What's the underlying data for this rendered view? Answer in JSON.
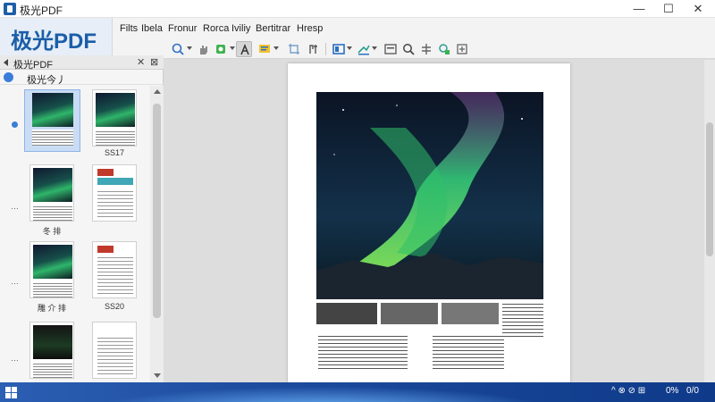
{
  "app": {
    "title": "极光PDF",
    "brand": "极光PDF"
  },
  "window_controls": {
    "minimize": "—",
    "maximize": "☐",
    "close": "✕"
  },
  "menu": [
    "Filts",
    "Ibela",
    "Fronur",
    "Rorca",
    "Iviliy",
    "Bertitrar",
    "Hresp"
  ],
  "panel": {
    "title": "极光PDF",
    "subtitle": "极光今丿",
    "close": "✕",
    "close2": "⊠"
  },
  "thumbnails": {
    "row_marks": [
      "…",
      "…",
      "…",
      "…"
    ],
    "labels": [
      "",
      "SS17",
      "",
      "",
      "冬 排",
      "",
      "雕 介 排",
      "SS20"
    ]
  },
  "tray": {
    "icons": "^ ⊗ ⊘ ⊞",
    "battery": "0%",
    "time": "0/0"
  },
  "icons": [
    "zoom-icon",
    "hand-icon",
    "rotate-icon",
    "highlight-icon",
    "text-select-icon",
    "comment-icon",
    "crop-icon",
    "link-icon",
    "view-icon",
    "sign-icon",
    "fit-icon",
    "search-icon",
    "split-icon",
    "ocr-icon",
    "more-icon"
  ],
  "colors": {
    "brand": "#1b5ea8",
    "accent": "#3b7dd8",
    "taskbar": "#1c4a9c"
  }
}
